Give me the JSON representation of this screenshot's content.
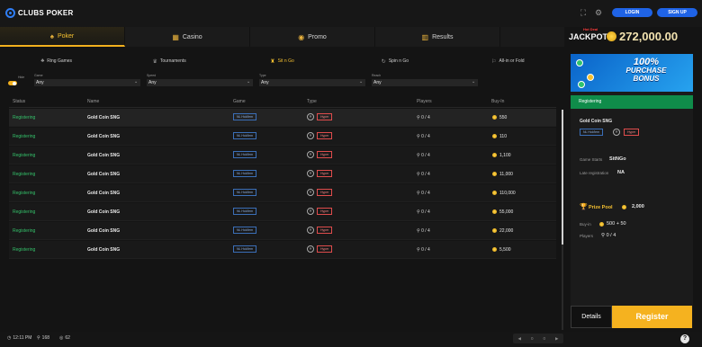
{
  "header": {
    "logo_text": "CLUBS POKER",
    "login_label": "LOGIN",
    "signup_label": "SIGN UP"
  },
  "nav": {
    "tabs": [
      {
        "label": "Poker",
        "icon": "poker-icon",
        "active": true
      },
      {
        "label": "Casino",
        "icon": "casino-icon",
        "active": false
      },
      {
        "label": "Promo",
        "icon": "promo-icon",
        "active": false
      },
      {
        "label": "Results",
        "icon": "results-icon",
        "active": false
      }
    ]
  },
  "jackpot": {
    "hot_label": "Hot Deal",
    "label": "JACKPOT",
    "amount": "272,000.00"
  },
  "subnav": {
    "tabs": [
      {
        "label": "Ring Games",
        "icon": "ring-games-icon",
        "active": false
      },
      {
        "label": "Tournaments",
        "icon": "trophy-icon",
        "active": false
      },
      {
        "label": "Sit n Go",
        "icon": "sit-n-go-icon",
        "active": true
      },
      {
        "label": "Spin n Go",
        "icon": "spin-icon",
        "active": false
      },
      {
        "label": "All-in or Fold",
        "icon": "all-in-icon",
        "active": false
      }
    ]
  },
  "filters": {
    "hide_label": "Hide",
    "items": [
      {
        "label": "Game",
        "value": "Any"
      },
      {
        "label": "Speed",
        "value": "Any"
      },
      {
        "label": "Type",
        "value": "Any"
      },
      {
        "label": "Reach",
        "value": "Any"
      }
    ]
  },
  "table": {
    "columns": [
      "Status",
      "Name",
      "Game",
      "Type",
      "Players",
      "Buy-In"
    ],
    "rows": [
      {
        "status": "Registering",
        "name": "Gold Coin SNG",
        "game": "NL Hold'em",
        "type": "Hyper",
        "players": "0 / 4",
        "buyin": "550"
      },
      {
        "status": "Registering",
        "name": "Gold Coin SNG",
        "game": "NL Hold'em",
        "type": "Hyper",
        "players": "0 / 4",
        "buyin": "110"
      },
      {
        "status": "Registering",
        "name": "Gold Coin SNG",
        "game": "NL Hold'em",
        "type": "Hyper",
        "players": "0 / 4",
        "buyin": "1,100"
      },
      {
        "status": "Registering",
        "name": "Gold Coin SNG",
        "game": "NL Hold'em",
        "type": "Hyper",
        "players": "0 / 4",
        "buyin": "11,000"
      },
      {
        "status": "Registering",
        "name": "Gold Coin SNG",
        "game": "NL Hold'em",
        "type": "Hyper",
        "players": "0 / 4",
        "buyin": "110,000"
      },
      {
        "status": "Registering",
        "name": "Gold Coin SNG",
        "game": "NL Hold'em",
        "type": "Hyper",
        "players": "0 / 4",
        "buyin": "55,000"
      },
      {
        "status": "Registering",
        "name": "Gold Coin SNG",
        "game": "NL Hold'em",
        "type": "Hyper",
        "players": "0 / 4",
        "buyin": "22,000"
      },
      {
        "status": "Registering",
        "name": "Gold Coin SNG",
        "game": "NL Hold'em",
        "type": "Hyper",
        "players": "0 / 4",
        "buyin": "5,500"
      }
    ]
  },
  "panel": {
    "banner_line1": "100%",
    "banner_line2": "PURCHASE",
    "banner_line3": "BONUS",
    "status": "Registering",
    "name": "Gold Coin SNG",
    "game": "NL Hold'em",
    "type": "Hyper",
    "game_starts_label": "Game Starts",
    "game_starts_value": "SitNGo",
    "late_reg_label": "Late registration",
    "late_reg_value": "NA",
    "prize_pool_label": "Prize Pool",
    "prize_pool_value": "2,000",
    "buyin_label": "Buy-in",
    "buyin_value": "500 + 50",
    "players_label": "Players",
    "players_value": "0 / 4",
    "details_label": "Details",
    "register_label": "Register"
  },
  "footer": {
    "time": "12:11 PM",
    "players_online": "168",
    "tables_count": "62",
    "pager_left": "0",
    "pager_right": "0"
  },
  "colors": {
    "accent_gold": "#f5b21f",
    "status_green": "#34c16a",
    "brand_blue": "#1f63e6",
    "hyper_red": "#e04c4c"
  }
}
